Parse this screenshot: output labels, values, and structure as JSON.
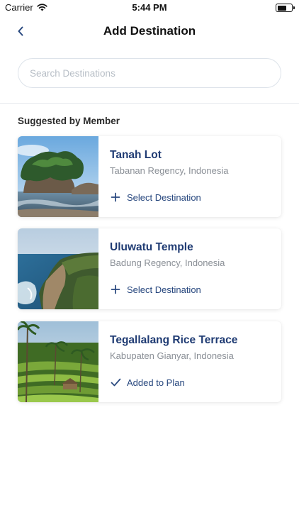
{
  "status_bar": {
    "carrier": "Carrier",
    "time": "5:44 PM",
    "battery_level": 0.7
  },
  "nav": {
    "title": "Add Destination",
    "back_icon": "chevron-left-icon"
  },
  "search": {
    "placeholder": "Search Destinations",
    "value": ""
  },
  "section": {
    "title": "Suggested by Member"
  },
  "destinations": [
    {
      "name": "Tanah Lot",
      "location": "Tabanan Regency, Indonesia",
      "action": "Select Destination",
      "action_icon": "plus-icon",
      "added": false
    },
    {
      "name": "Uluwatu Temple",
      "location": "Badung Regency, Indonesia",
      "action": "Select Destination",
      "action_icon": "plus-icon",
      "added": false
    },
    {
      "name": "Tegallalang Rice Terrace",
      "location": "Kabupaten Gianyar, Indonesia",
      "action": "Added to Plan",
      "action_icon": "check-icon",
      "added": true
    }
  ],
  "colors": {
    "accent": "#27477e",
    "title": "#1f3b73",
    "muted": "#8a8f96"
  }
}
